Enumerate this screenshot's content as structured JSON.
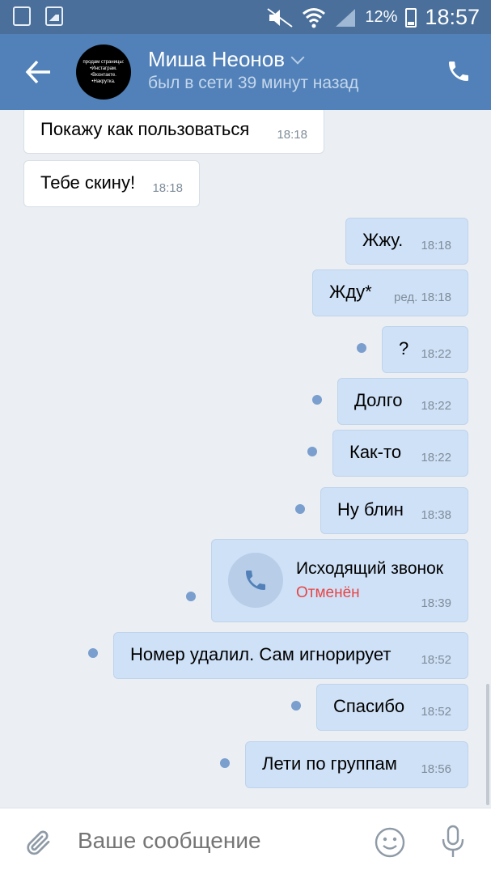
{
  "status_bar": {
    "battery": "12%",
    "time": "18:57"
  },
  "header": {
    "name": "Миша Неонов",
    "status": "был в сети 39 минут назад",
    "avatar_text": "продам страницы: •Инстаграм. •Вконтакте. •Накрутка."
  },
  "messages": [
    {
      "dir": "in",
      "text": "Покажу как пользоваться",
      "time": "18:18"
    },
    {
      "dir": "in",
      "text": "Тебе скину!",
      "time": "18:18"
    },
    {
      "dir": "out",
      "text": "Жжу.",
      "time": "18:18"
    },
    {
      "dir": "out",
      "text": "Жду*",
      "time": "ред. 18:18"
    },
    {
      "dir": "out",
      "text": "?",
      "time": "18:22"
    },
    {
      "dir": "out",
      "text": "Долго",
      "time": "18:22"
    },
    {
      "dir": "out",
      "text": "Как-то",
      "time": "18:22"
    },
    {
      "dir": "out",
      "text": "Ну блин",
      "time": "18:38"
    },
    {
      "dir": "out",
      "title": "Исходящий звонок",
      "state": "Отменён",
      "time": "18:39"
    },
    {
      "dir": "out",
      "text": "Номер удалил. Сам игнорирует",
      "time": "18:52"
    },
    {
      "dir": "out",
      "text": "Спасибо",
      "time": "18:52"
    },
    {
      "dir": "out",
      "text": "Лети по группам",
      "time": "18:56"
    }
  ],
  "composer": {
    "placeholder": "Ваше сообщение"
  },
  "colors": {
    "header": "#5181b8",
    "bubble_out": "#cfe1f7",
    "unread_dot": "#7a9ecd",
    "missed": "#e64646"
  }
}
